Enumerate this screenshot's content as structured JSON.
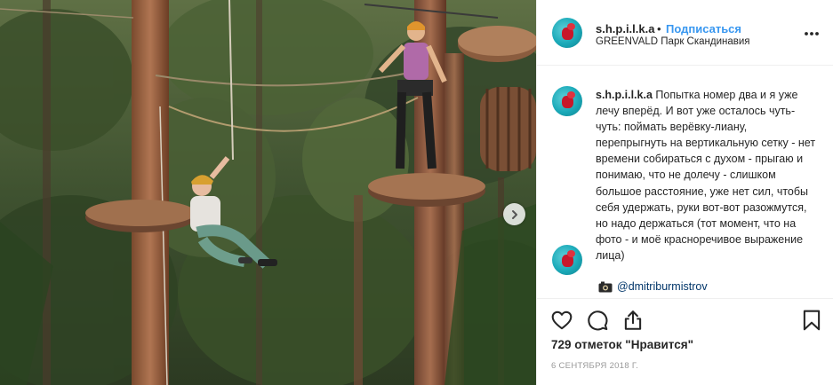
{
  "post": {
    "username": "s.h.p.i.l.k.a",
    "separator": "•",
    "follow_label": "Подписаться",
    "location": "GREENVALD Парк Скандинавия",
    "more_icon": "more-horizontal-icon"
  },
  "caption": {
    "username": "s.h.p.i.l.k.a",
    "text": "Попытка номер два и я уже лечу вперёд. И вот уже осталось чуть-чуть: поймать верёвку-лиану, перепрыгнуть на вертикальную сетку - нет времени собираться с духом - прыгаю и понимаю, что не долечу - слишком большое расстояние, уже нет сил, чтобы себя удержать, руки вот-вот разожмутся, но надо держаться (тот момент, что на фото - и моё красноречивое выражение лица)",
    "mention": "@dmitriburmistrov",
    "camera_icon": "camera-icon"
  },
  "actions": {
    "like_icon": "heart-icon",
    "comment_icon": "comment-icon",
    "share_icon": "share-icon",
    "save_icon": "bookmark-icon"
  },
  "likes_text": "729 отметок \"Нравится\"",
  "date_text": "6 СЕНТЯБРЯ 2018 Г.",
  "carousel": {
    "next_icon": "chevron-right-icon"
  },
  "colors": {
    "follow": "#3897f0",
    "mention": "#003569",
    "muted": "#999999",
    "text": "#262626"
  }
}
